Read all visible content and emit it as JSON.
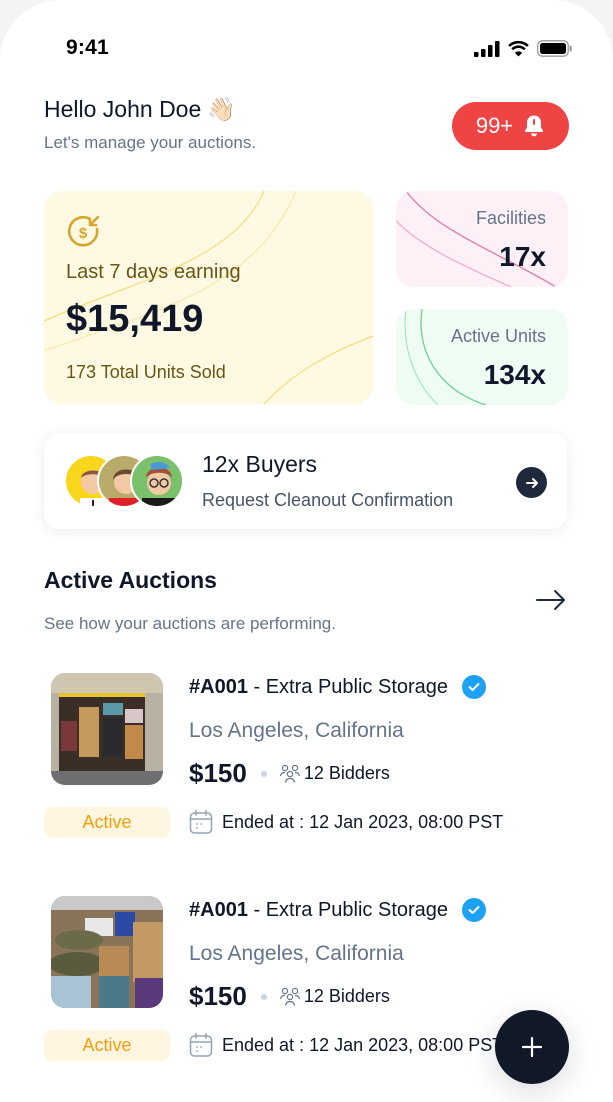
{
  "status_bar": {
    "time": "9:41",
    "icons": [
      "cellular-signal-icon",
      "wifi-icon",
      "battery-icon"
    ]
  },
  "header": {
    "title": "Hello John Doe",
    "emoji": "👋🏻",
    "subtitle": "Let's manage your auctions.",
    "notification_count": "99+"
  },
  "earnings": {
    "icon": "dollar-receive-icon",
    "label": "Last 7 days earning",
    "value": "$15,419",
    "sub": "173 Total Units Sold"
  },
  "stats": {
    "facilities": {
      "label": "Facilities",
      "value": "17x"
    },
    "active_units": {
      "label": "Active Units",
      "value": "134x"
    }
  },
  "buyers": {
    "title": "12x Buyers",
    "subtitle": "Request Cleanout Confirmation",
    "avatars": [
      "avatar-man-yellow",
      "avatar-woman-olive",
      "avatar-man-green"
    ]
  },
  "section": {
    "title": "Active Auctions",
    "subtitle": "See how your auctions are performing."
  },
  "auctions": [
    {
      "id": "#A001",
      "separator": " - ",
      "name": "Extra Public Storage",
      "location": "Los Angeles, California",
      "price": "$150",
      "bidders": "12 Bidders",
      "ended": "Ended at : 12 Jan 2023, 08:00 PST",
      "status": "Active"
    },
    {
      "id": "#A001",
      "separator": " - ",
      "name": "Extra Public Storage",
      "location": "Los Angeles, California",
      "price": "$150",
      "bidders": "12 Bidders",
      "ended": "Ended at : 12 Jan 2023, 08:00 PST",
      "status": "Active"
    }
  ],
  "colors": {
    "notification": "#ef4444",
    "earn_card": "#fef9e3",
    "facilities_card": "#fdf0f6",
    "units_card": "#effcf3",
    "status_active": "#f59e0b",
    "verified": "#1da1f2",
    "fab": "#111827"
  }
}
